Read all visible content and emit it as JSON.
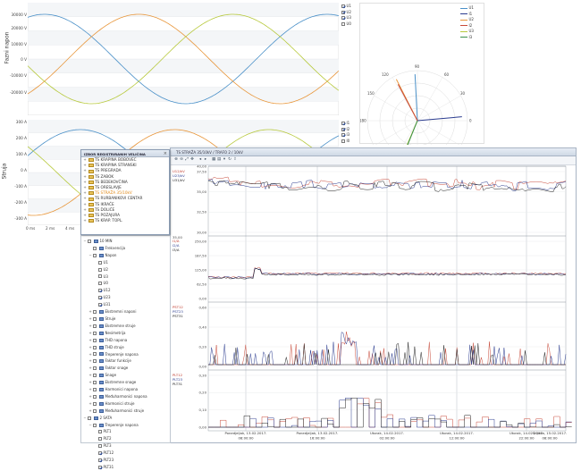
{
  "colors": {
    "U1": "#4a90c8",
    "U2": "#e8963a",
    "U3": "#b7c93c",
    "I1": "#4a90c8",
    "I2": "#e8963a",
    "I3": "#b7c93c",
    "U1p": "#2a3b8f",
    "U2p": "#c84a3a",
    "U3p": "#3a8f4a",
    "black": "#222222"
  },
  "voltage_chart": {
    "ylabel": "Fazni napon",
    "ticks": [
      "20000 V",
      "10000 V",
      "0 V",
      "-10000 V",
      "-20000 V"
    ],
    "ticks_top": "30000 V",
    "legend": [
      "U1",
      "U2",
      "U3",
      "U0"
    ],
    "legend_checked": [
      true,
      true,
      true,
      false
    ]
  },
  "current_chart": {
    "ylabel": "Struja",
    "ticks": [
      "300 A",
      "200 A",
      "100 A",
      "0 A",
      "-100 A",
      "-200 A",
      "-300 A"
    ],
    "legend": [
      "I1",
      "I2",
      "I3",
      "I0"
    ],
    "legend_checked": [
      true,
      true,
      true,
      false
    ],
    "xticks": [
      "0 ms",
      "2 ms",
      "4 ms"
    ]
  },
  "phasor": {
    "angles": [
      "90",
      "60",
      "120",
      "30",
      "150",
      "0",
      "180",
      "210",
      "330"
    ],
    "legend": [
      "U1",
      "I1",
      "U2",
      "I2",
      "U3",
      "I3"
    ]
  },
  "station_list": {
    "title": "IZBOR REGISTRIRANIH VELIČINA",
    "stations": [
      "TS KRAPINA BOBOVEC",
      "TS KRAPINA STRANSKI",
      "TS PREGRADA",
      "TS ZABOK",
      "TS BEDEKOVČINA",
      "TS ORESLAVJE",
      "TS STRAŽA 35/10kV",
      "TS RURBANIKOVI CENTAR",
      "TS IKRAČE",
      "TS DOLIČE",
      "TS POZAJURA",
      "TS KRAP. TOPL."
    ],
    "selected_index": 6
  },
  "tree": {
    "items": [
      {
        "label": "10 MIN",
        "level": 0,
        "box": true,
        "check": false,
        "exp": "−"
      },
      {
        "label": "Frekvencija",
        "level": 1,
        "box": true,
        "check": false,
        "exp": ""
      },
      {
        "label": "Napon",
        "level": 1,
        "box": true,
        "check": false,
        "exp": "−"
      },
      {
        "label": "U1",
        "level": 2,
        "box": true,
        "check": false,
        "exp": ""
      },
      {
        "label": "U2",
        "level": 2,
        "box": true,
        "check": false,
        "exp": ""
      },
      {
        "label": "U3",
        "level": 2,
        "box": true,
        "check": false,
        "exp": ""
      },
      {
        "label": "U0",
        "level": 2,
        "box": true,
        "check": false,
        "exp": ""
      },
      {
        "label": "U12",
        "level": 2,
        "box": true,
        "check": true,
        "exp": ""
      },
      {
        "label": "U23",
        "level": 2,
        "box": true,
        "check": true,
        "exp": ""
      },
      {
        "label": "U31",
        "level": 2,
        "box": true,
        "check": true,
        "exp": ""
      },
      {
        "label": "Ekstremni naponi",
        "level": 1,
        "box": true,
        "check": false,
        "exp": "+"
      },
      {
        "label": "Struje",
        "level": 1,
        "box": true,
        "check": false,
        "exp": "+"
      },
      {
        "label": "Ekstremne struje",
        "level": 1,
        "box": true,
        "check": false,
        "exp": "+"
      },
      {
        "label": "Nesimetrija",
        "level": 1,
        "box": true,
        "check": false,
        "exp": "+"
      },
      {
        "label": "THD napona",
        "level": 1,
        "box": true,
        "check": false,
        "exp": "+"
      },
      {
        "label": "THD struje",
        "level": 1,
        "box": true,
        "check": false,
        "exp": "+"
      },
      {
        "label": "Treperenje napona",
        "level": 1,
        "box": true,
        "check": false,
        "exp": "+"
      },
      {
        "label": "Faktor funkcije",
        "level": 1,
        "box": true,
        "check": false,
        "exp": "+"
      },
      {
        "label": "Faktor snage",
        "level": 1,
        "box": true,
        "check": false,
        "exp": "+"
      },
      {
        "label": "Snage",
        "level": 1,
        "box": true,
        "check": false,
        "exp": "+"
      },
      {
        "label": "Ekstremne snage",
        "level": 1,
        "box": true,
        "check": false,
        "exp": "+"
      },
      {
        "label": "Harmonici napona",
        "level": 1,
        "box": true,
        "check": false,
        "exp": "+"
      },
      {
        "label": "Međuharmonici napona",
        "level": 1,
        "box": true,
        "check": false,
        "exp": "+"
      },
      {
        "label": "Harmonici struje",
        "level": 1,
        "box": true,
        "check": false,
        "exp": "+"
      },
      {
        "label": "Međuharmonici struje",
        "level": 1,
        "box": true,
        "check": false,
        "exp": "+"
      },
      {
        "label": "2 SATA",
        "level": 0,
        "box": true,
        "check": false,
        "exp": "−"
      },
      {
        "label": "Treperenje napona",
        "level": 1,
        "box": true,
        "check": false,
        "exp": "−"
      },
      {
        "label": "PLT1",
        "level": 2,
        "box": true,
        "check": false,
        "exp": ""
      },
      {
        "label": "PLT2",
        "level": 2,
        "box": true,
        "check": false,
        "exp": ""
      },
      {
        "label": "PLT3",
        "level": 2,
        "box": true,
        "check": false,
        "exp": ""
      },
      {
        "label": "PLT12",
        "level": 2,
        "box": true,
        "check": true,
        "exp": ""
      },
      {
        "label": "PLT23",
        "level": 2,
        "box": true,
        "check": true,
        "exp": ""
      },
      {
        "label": "PLT31",
        "level": 2,
        "box": true,
        "check": true,
        "exp": ""
      }
    ]
  },
  "trend_window": {
    "title": "TS STRAŽA 35/10kV / TRAFO 2 / 10kV",
    "panels": [
      {
        "labels": [
          "U12/kV",
          "U23/kV",
          "U31/kV"
        ],
        "ticks": [
          "37,50",
          "35,00",
          "32,50",
          "30,00"
        ]
      },
      {
        "labels": [
          "I1/A",
          "I2/A",
          "I3/A"
        ],
        "ticks": [
          "250,00",
          "187,50",
          "125,00",
          "62,50",
          "0,00"
        ]
      },
      {
        "labels": [
          "PST12",
          "PST23",
          "PST31"
        ],
        "ticks": [
          "0,60",
          "0,40",
          "0,20",
          "0,00"
        ]
      },
      {
        "labels": [
          "PLT12",
          "PLT23",
          "PLT31"
        ],
        "ticks": [
          "0,30",
          "0,20",
          "0,10",
          "0,00"
        ]
      }
    ],
    "top_label": "40,00",
    "left_top_label": "35,00",
    "x_labels": [
      {
        "day": "Ponedjeljak, 13.02.2017.",
        "time": "08:00:00"
      },
      {
        "day": "Ponedjeljak, 13.02.2017.",
        "time": "16:00:00"
      },
      {
        "day": "Utorak, 14.02.2017.",
        "time": "02:00:00"
      },
      {
        "day": "Utorak, 14.02.2017.",
        "time": "12:00:00"
      },
      {
        "day": "Utorak, 14.02.2017.",
        "time": "22:00:00"
      },
      {
        "day": "Srijeda, 15.02.2017.",
        "time": "08:00:00"
      }
    ]
  }
}
